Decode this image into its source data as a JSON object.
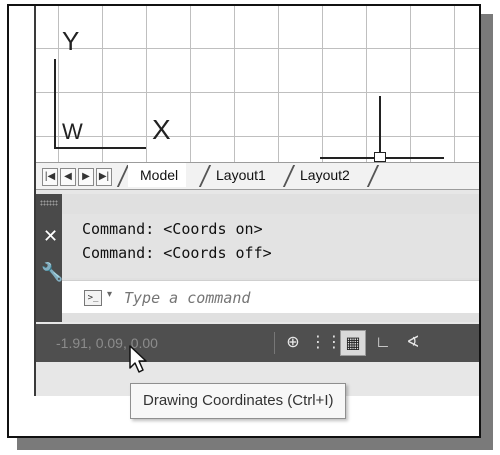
{
  "canvas": {
    "ucs": {
      "y_label": "Y",
      "w_label": "W",
      "x_label": "X"
    }
  },
  "tabs": {
    "nav": [
      "|◀",
      "◀",
      "▶",
      "▶|"
    ],
    "items": [
      "Model",
      "Layout1",
      "Layout2"
    ],
    "active": "Model"
  },
  "command": {
    "history": [
      "Command:  <Coords on>",
      "Command:  <Coords off>"
    ],
    "prompt_icon": ">_",
    "placeholder": "Type a command"
  },
  "statusbar": {
    "coordinates": "-1.91, 0.09, 0.00",
    "buttons": [
      {
        "icon": "snap-cursor-icon",
        "glyph": "⊕"
      },
      {
        "icon": "grid-dots-icon",
        "glyph": "⋮⋮"
      },
      {
        "icon": "grid-display-icon",
        "glyph": "▦",
        "active": true
      },
      {
        "icon": "ortho-icon",
        "glyph": "∟"
      },
      {
        "icon": "polar-tracking-icon",
        "glyph": "∢"
      }
    ]
  },
  "tooltip": {
    "text": "Drawing Coordinates (Ctrl+I)"
  }
}
